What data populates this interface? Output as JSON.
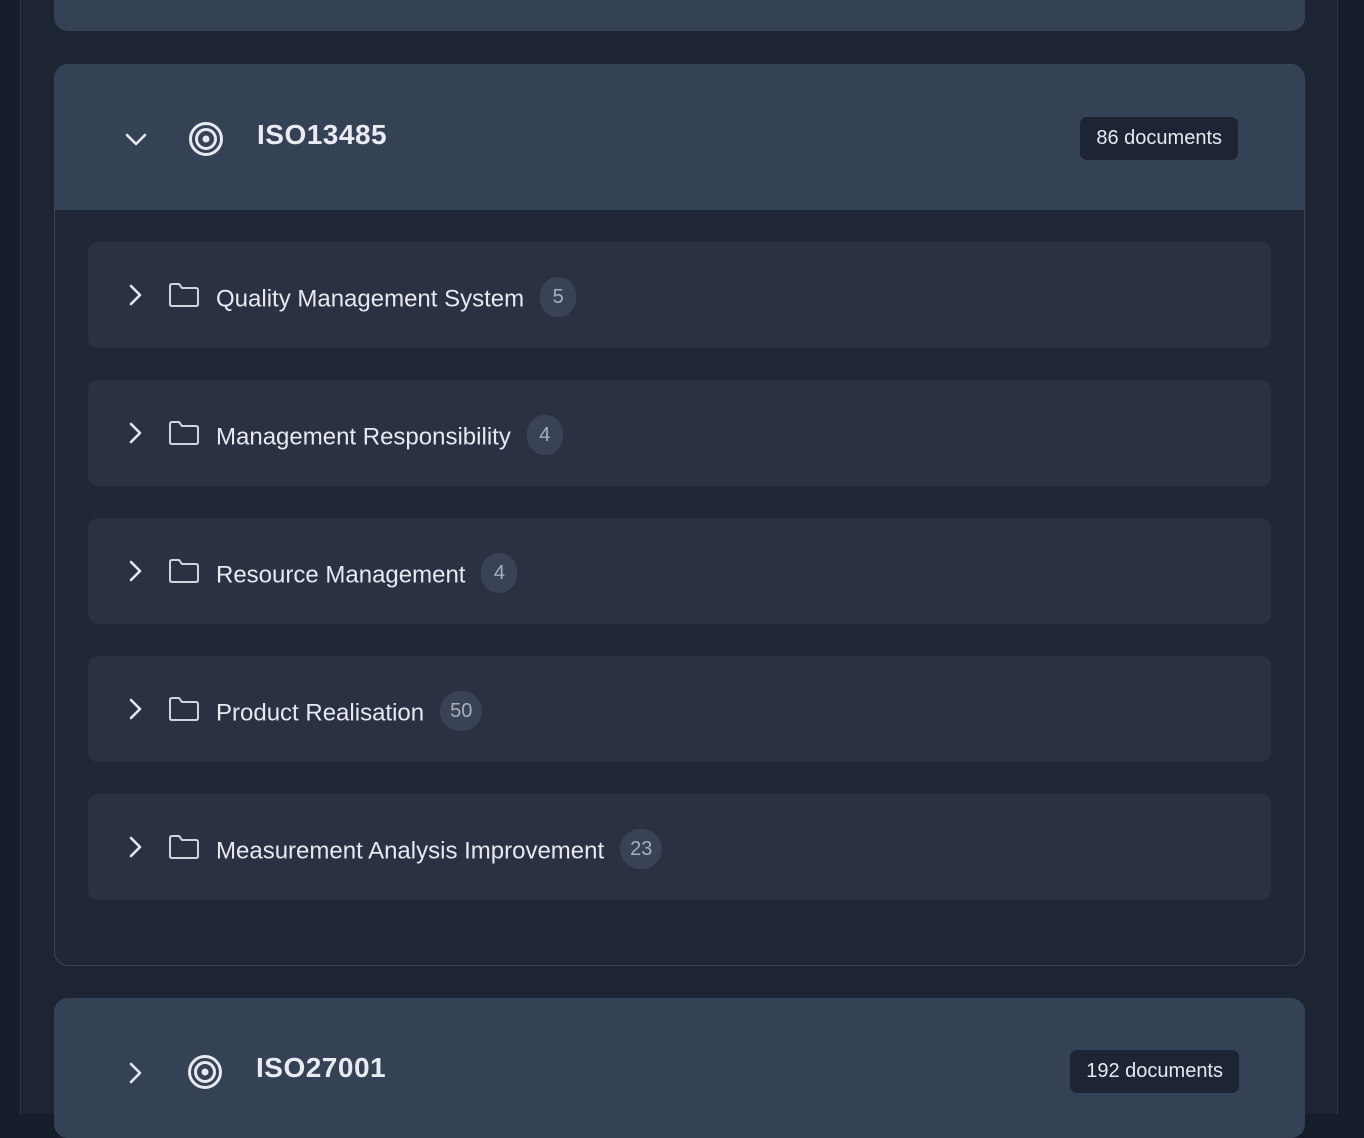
{
  "groups": [
    {
      "title": "ISO13485",
      "doc_count_label": "86 documents",
      "expanded": true,
      "folders": [
        {
          "label": "Quality Management System",
          "count": "5"
        },
        {
          "label": "Management Responsibility",
          "count": "4"
        },
        {
          "label": "Resource Management",
          "count": "4"
        },
        {
          "label": "Product Realisation",
          "count": "50"
        },
        {
          "label": "Measurement Analysis Improvement",
          "count": "23"
        }
      ]
    },
    {
      "title": "ISO27001",
      "doc_count_label": "192 documents",
      "expanded": false
    }
  ],
  "colors": {
    "page_bg": "#161d2b",
    "panel_bg": "#1d2535",
    "group_header_bg": "#354155",
    "folder_row_bg": "#2a3143",
    "count_badge_bg": "#3a4356",
    "text": "#e6e9ef"
  },
  "icons": {
    "group": "target-icon",
    "folder": "folder-icon",
    "expanded": "chevron-down-icon",
    "collapsed": "chevron-right-icon"
  }
}
